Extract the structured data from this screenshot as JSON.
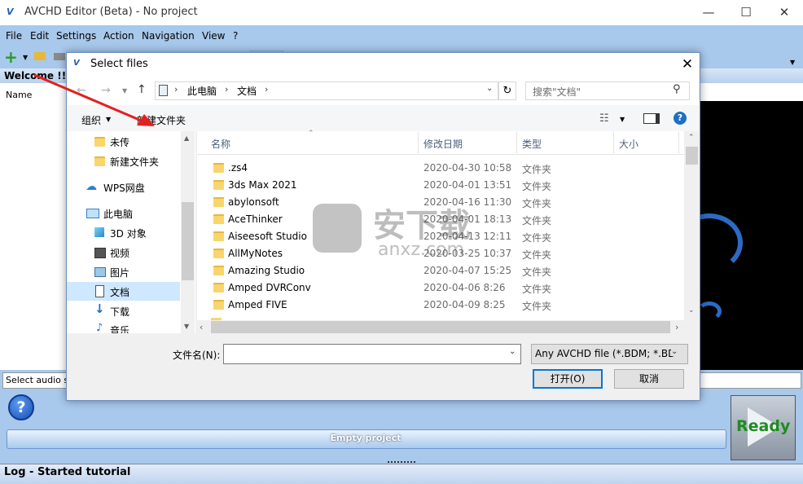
{
  "app": {
    "title": "AVCHD Editor (Beta) - No project",
    "menu": [
      "File",
      "Edit",
      "Settings",
      "Action",
      "Navigation",
      "View",
      "?"
    ],
    "welcome": "Welcome !!!",
    "name_col": "Name",
    "audio_box": "Select audio str",
    "progress_text": "Empty project",
    "ready_label": "Ready",
    "log_text": "Log - Started tutorial",
    "help_glyph": "?",
    "accent": "#a8c8ec"
  },
  "dialog": {
    "title": "Select files",
    "close_glyph": "✕",
    "path": [
      "此电脑",
      "文档"
    ],
    "search_placeholder": "搜索\"文档\"",
    "organize": "组织",
    "new_folder": "新建文件夹",
    "nav_items": [
      {
        "label": "未传",
        "icon": "folder-icon"
      },
      {
        "label": "新建文件夹",
        "icon": "folder-icon"
      },
      {
        "label": "WPS网盘",
        "icon": "cloud-icon"
      },
      {
        "label": "此电脑",
        "icon": "computer-icon"
      },
      {
        "label": "3D 对象",
        "icon": "cube-icon"
      },
      {
        "label": "视频",
        "icon": "video-icon"
      },
      {
        "label": "图片",
        "icon": "picture-icon"
      },
      {
        "label": "文档",
        "icon": "document-icon"
      },
      {
        "label": "下载",
        "icon": "download-icon"
      },
      {
        "label": "音乐",
        "icon": "music-icon"
      }
    ],
    "columns": [
      "名称",
      "修改日期",
      "类型",
      "大小"
    ],
    "files": [
      {
        "name": ".zs4",
        "date": "2020-04-30 10:58",
        "type": "文件夹"
      },
      {
        "name": "3ds Max 2021",
        "date": "2020-04-01 13:51",
        "type": "文件夹"
      },
      {
        "name": "abylonsoft",
        "date": "2020-04-16 11:30",
        "type": "文件夹"
      },
      {
        "name": "AceThinker",
        "date": "2020-04-01 18:13",
        "type": "文件夹"
      },
      {
        "name": "Aiseesoft Studio",
        "date": "2020-04-13 12:11",
        "type": "文件夹"
      },
      {
        "name": "AllMyNotes",
        "date": "2020-03-25 10:37",
        "type": "文件夹"
      },
      {
        "name": "Amazing Studio",
        "date": "2020-04-07 15:25",
        "type": "文件夹"
      },
      {
        "name": "Amped DVRConv",
        "date": "2020-04-06 8:26",
        "type": "文件夹"
      },
      {
        "name": "Amped FIVE",
        "date": "2020-04-09 8:25",
        "type": "文件夹"
      }
    ],
    "filename_label": "文件名(N):",
    "filename_value": "",
    "filter_value": "Any AVCHD file  (*.BDM; *.BD",
    "open_label": "打开(O)",
    "cancel_label": "取消"
  },
  "watermark": {
    "text": "安下载",
    "subtext": "anxz.com"
  }
}
